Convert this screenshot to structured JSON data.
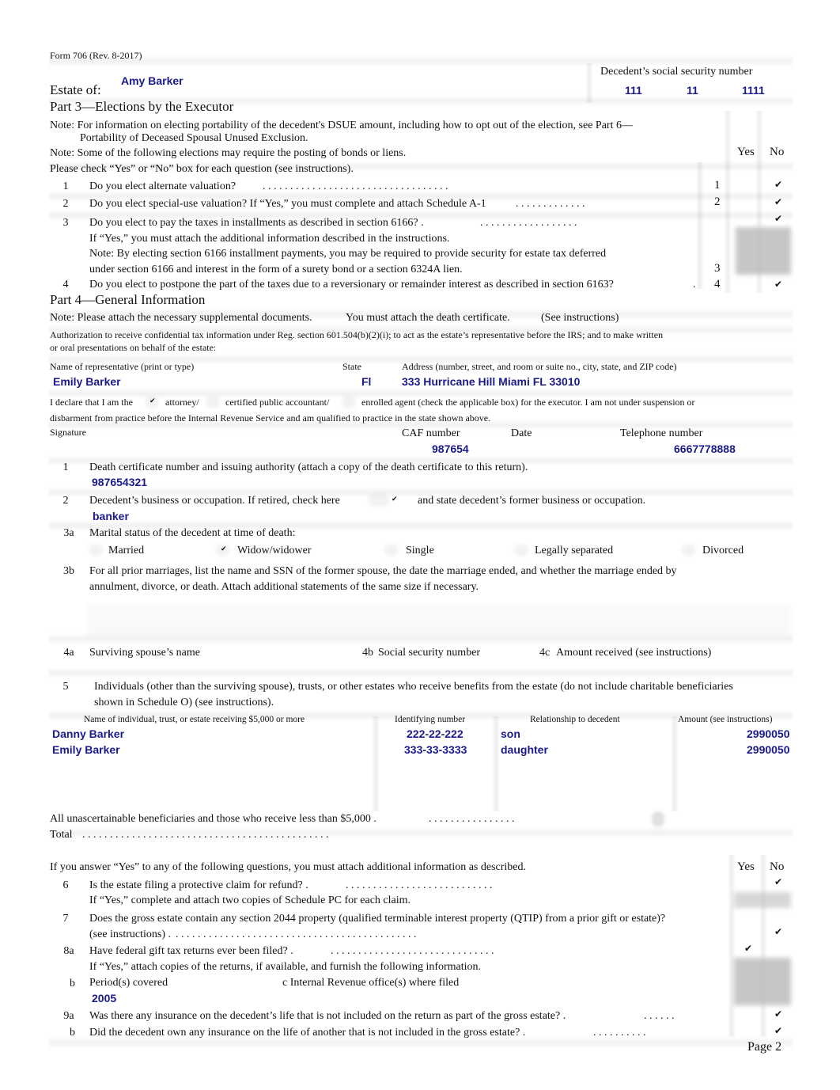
{
  "header": {
    "form_id": "Form 706 (Rev. 8-2017)",
    "estate_label": "Estate of:",
    "estate_name": "Amy Barker",
    "ssn_label": "Decedent’s social security number",
    "ssn_parts": [
      "111",
      "11",
      "1111"
    ]
  },
  "part3": {
    "title": "Part 3—Elections by the Executor",
    "note1_line1": "Note:  For information on electing portability of the decedent's DSUE amount, including how to opt out of the election, see Part 6—",
    "note1_line2": "Portability of Deceased Spousal Unused Exclusion.",
    "note2": "Note:  Some of the following elections may require the posting of bonds or liens.",
    "instruction": "Please check “Yes” or “No” box for each question (see instructions).",
    "yes_label": "Yes",
    "no_label": "No",
    "questions": [
      {
        "num": "1",
        "text": "Do you elect alternate valuation?",
        "dots": ". . . . . . . . . . . . . . . . . . . . . . . . . . . . . . . . . .",
        "line": "1",
        "answer": "No",
        "mark": "✔"
      },
      {
        "num": "2",
        "text": "Do you elect special-use valuation? If “Yes,” you must complete and attach Schedule A-1",
        "dots": ". . . . . . . . . . . . .",
        "line": "2",
        "answer": "No",
        "mark": "✔"
      },
      {
        "num": "3",
        "text": "Do you elect to pay the taxes in installments as described in section 6166? .",
        "dots": ". . . . . . . . . . . . . . . . . .",
        "line": "3",
        "answer": "No",
        "mark": "✔",
        "sub1": "If “Yes,” you must attach the additional information described in the instructions.",
        "sub2": "Note: By electing section 6166 installment payments, you may be required to provide security for estate tax deferred",
        "sub3": "under section 6166 and interest in the form of a surety bond or a section 6324A lien."
      },
      {
        "num": "4",
        "text": "Do you elect to postpone the part of the taxes due to a reversionary or remainder interest as described in section 6163?",
        "dots": ".",
        "line": "4",
        "answer": "No",
        "mark": "✔"
      }
    ]
  },
  "part4": {
    "title": "Part 4—General Information",
    "note_a": "Note:  Please attach the necessary supplemental documents.",
    "note_b": "You must attach the death certificate.",
    "note_c": "(See instructions)",
    "auth_line1": "Authorization to receive confidential tax information under Reg. section 601.504(b)(2)(i); to act as the estate’s representative before the IRS; and to make written",
    "auth_line2": "or oral presentations on behalf of the estate:",
    "rep_name_label": "Name of representative (print or type)",
    "rep_name": "Emily Barker",
    "state_label": "State",
    "state": "Fl",
    "address_label": "Address (number, street, and room or suite no., city, state, and ZIP code)",
    "address": "333 Hurricane Hill Miami FL 33010",
    "declare_prefix": "I declare that I am the",
    "declare_attorney": "attorney/",
    "declare_cpa": "certified public accountant/",
    "declare_agent": "enrolled agent (check the applicable box) for the executor. I am not under suspension or",
    "declare_line2": "disbarment from practice before the Internal Revenue Service and am qualified to practice in the state shown above.",
    "declare_checked": "attorney",
    "check_mark": "✔",
    "signature_label": "Signature",
    "caf_label": "CAF number",
    "caf": "987654",
    "date_label": "Date",
    "date": "",
    "phone_label": "Telephone number",
    "phone": "6667778888",
    "q1_num": "1",
    "q1_text": "Death certificate number and issuing authority (attach a copy of the death certificate to this return).",
    "q1_value": "987654321",
    "q2_num": "2",
    "q2_text_a": "Decedent’s business or occupation. If retired, check here",
    "q2_text_b": "and state decedent’s former business or occupation.",
    "q2_retired_checked": true,
    "q2_value": "banker",
    "q3a_num": "3a",
    "q3a_text": "Marital status of the decedent at time of death:",
    "marital_options": [
      {
        "label": "Married",
        "checked": false
      },
      {
        "label": "Widow/widower",
        "checked": true
      },
      {
        "label": "Single",
        "checked": false
      },
      {
        "label": "Legally separated",
        "checked": false
      },
      {
        "label": "Divorced",
        "checked": false
      }
    ],
    "q3b_num": "3b",
    "q3b_line1": "For all prior marriages, list the name and SSN of the former spouse, the date the marriage ended, and whether the marriage ended by",
    "q3b_line2": "annulment, divorce, or death. Attach additional statements of the same size if necessary.",
    "q3b_value": "",
    "q4a_num": "4a",
    "q4a_text": "Surviving spouse’s name",
    "q4b_num": "4b",
    "q4b_text": "Social security number",
    "q4c_num": "4c",
    "q4c_text": "Amount received (see instructions)",
    "q5_num": "5",
    "q5_line1": "Individuals (other than the surviving spouse), trusts, or other estates who receive benefits from the estate (do not include charitable beneficiaries",
    "q5_line2": "shown in Schedule O) (see instructions).",
    "beneficiary_table": {
      "headers": [
        "Name of individual, trust, or estate receiving $5,000 or more",
        "Identifying number",
        "Relationship to decedent",
        "Amount (see instructions)"
      ],
      "rows": [
        {
          "name": "Danny Barker",
          "id": "222-22-222",
          "relationship": "son",
          "amount": "2990050"
        },
        {
          "name": "Emily Barker",
          "id": "333-33-3333",
          "relationship": "daughter",
          "amount": "2990050"
        }
      ]
    },
    "unascertainable_label": "All unascertainable beneficiaries and those who receive less than $5,000 .",
    "unascertainable_dots": ". . . . . . . . . . . . . . . .",
    "total_label": "Total",
    "total_dots": ". . . . . . . . . . . . . . . . . . . . . . . . . . . . . . . . . . . . . . . . . . . . .",
    "additional_intro": "If you answer “Yes” to any of the following questions, you must attach additional information as described.",
    "yes_label": "Yes",
    "no_label": "No",
    "q6_num": "6",
    "q6_text": "Is the estate filing a protective claim for refund? .",
    "q6_dots": ". . . . . . . . . . . . . . . . . . . . . . . . . . .",
    "q6_sub": "If “Yes,” complete and attach two copies of Schedule PC for each claim.",
    "q6_answer": "No",
    "q7_num": "7",
    "q7_line1": "Does the gross estate contain any section 2044 property (qualified terminable interest property (QTIP) from a prior gift or estate)?",
    "q7_line2": "(see  instructions) .",
    "q7_dots": ". . . . . . . . . . . . . . . . . . . . . . . . . . . . . . . . . . . . . . . . . . . .",
    "q7_answer": "No",
    "q8a_num": "8a",
    "q8a_text": "Have federal gift tax returns ever been filed? .",
    "q8a_dots": ". . . . . . . . . . . . . . . . . . . . . . . . . . . . . .",
    "q8a_sub": "If “Yes,” attach copies of the returns, if available, and furnish the following information.",
    "q8a_answer": "Yes",
    "q8b_num": "b",
    "q8b_text": "Period(s) covered",
    "q8b_value": "2005",
    "q8c_text": "c  Internal Revenue office(s) where filed",
    "q8c_value": "",
    "q9a_num": "9a",
    "q9a_text": "Was there any insurance on the decedent’s life that is not included on the return as part of the gross estate? .",
    "q9a_dots": ". . . . . .",
    "q9a_answer": "No",
    "q9b_num": "b",
    "q9b_text": "Did the decedent own any insurance on the life of another that is not included in the gross estate? .",
    "q9b_dots": ". . . . . . . . . .",
    "q9b_answer": "No"
  },
  "footer": {
    "page": "Page 2"
  }
}
